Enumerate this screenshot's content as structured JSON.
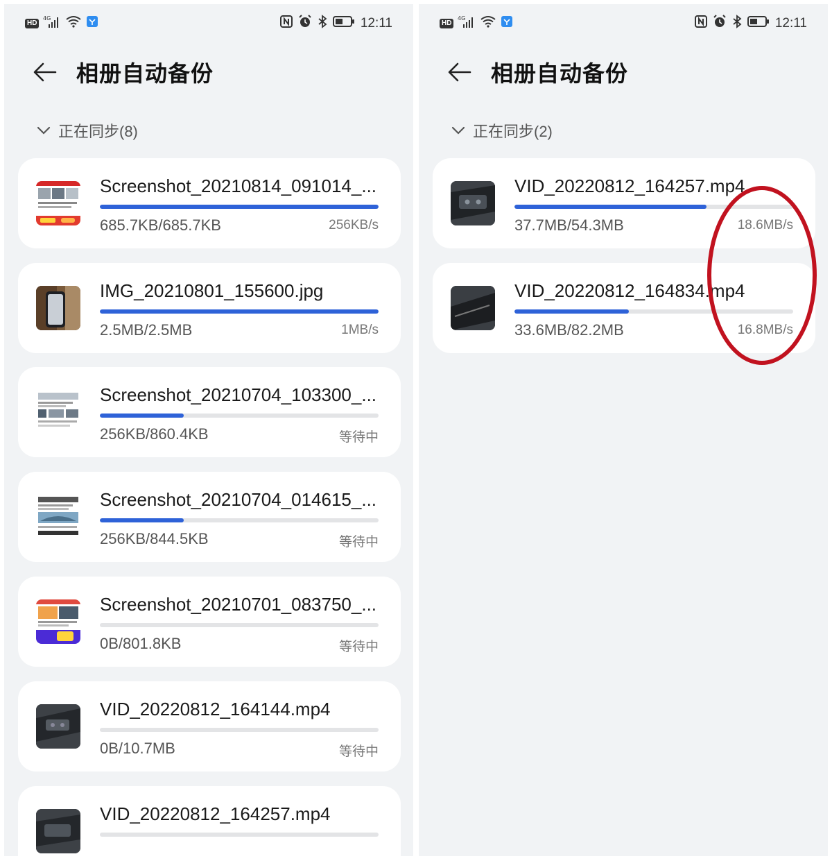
{
  "left": {
    "status": {
      "network": "4G",
      "time": "12:11"
    },
    "title": "相册自动备份",
    "group_label": "正在同步(8)",
    "items": [
      {
        "name": "Screenshot_20210814_091014_...",
        "progress": 1.0,
        "size": "685.7KB/685.7KB",
        "status": "256KB/s",
        "thumb": "screenshot-thumbnail"
      },
      {
        "name": "IMG_20210801_155600.jpg",
        "progress": 1.0,
        "size": "2.5MB/2.5MB",
        "status": "1MB/s",
        "thumb": "photo-thumbnail"
      },
      {
        "name": "Screenshot_20210704_103300_...",
        "progress": 0.3,
        "size": "256KB/860.4KB",
        "status": "等待中",
        "thumb": "screenshot-thumbnail"
      },
      {
        "name": "Screenshot_20210704_014615_...",
        "progress": 0.3,
        "size": "256KB/844.5KB",
        "status": "等待中",
        "thumb": "screenshot-thumbnail"
      },
      {
        "name": "Screenshot_20210701_083750_...",
        "progress": 0.0,
        "size": "0B/801.8KB",
        "status": "等待中",
        "thumb": "screenshot-thumbnail"
      },
      {
        "name": "VID_20220812_164144.mp4",
        "progress": 0.0,
        "size": "0B/10.7MB",
        "status": "等待中",
        "thumb": "video-thumbnail"
      },
      {
        "name": "VID_20220812_164257.mp4",
        "progress": 0.0,
        "size": "",
        "status": "",
        "thumb": "video-thumbnail"
      }
    ]
  },
  "right": {
    "status": {
      "network": "4G",
      "time": "12:11"
    },
    "title": "相册自动备份",
    "group_label": "正在同步(2)",
    "items": [
      {
        "name": "VID_20220812_164257.mp4",
        "progress": 0.69,
        "size": "37.7MB/54.3MB",
        "status": "18.6MB/s",
        "thumb": "video-thumbnail"
      },
      {
        "name": "VID_20220812_164834.mp4",
        "progress": 0.41,
        "size": "33.6MB/82.2MB",
        "status": "16.8MB/s",
        "thumb": "video-thumbnail"
      }
    ]
  },
  "colors": {
    "accent": "#2e62d8",
    "track": "#e3e4e6",
    "background": "#f1f3f5",
    "card": "#ffffff",
    "annotation": "#c1121f"
  },
  "icons": [
    "hd-icon",
    "signal-icon",
    "wifi-icon",
    "app-icon",
    "nfc-icon",
    "alarm-icon",
    "bluetooth-icon",
    "battery-icon",
    "back-arrow-icon",
    "chevron-down-icon"
  ]
}
